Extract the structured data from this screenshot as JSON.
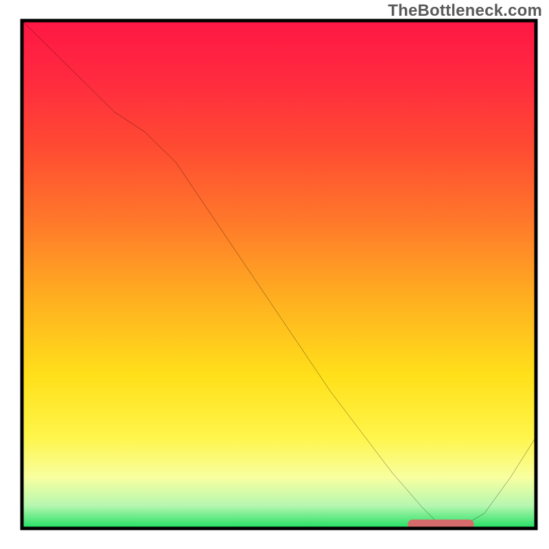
{
  "watermark": "TheBottleneck.com",
  "colors": {
    "frame": "#000000",
    "curve": "#000000",
    "target_marker_fill": "#d76a6a",
    "target_marker_stroke": "#c85a5a",
    "gradient_stops": [
      {
        "offset": 0.0,
        "color": "#ff1744"
      },
      {
        "offset": 0.12,
        "color": "#ff2b3f"
      },
      {
        "offset": 0.25,
        "color": "#ff4b32"
      },
      {
        "offset": 0.4,
        "color": "#ff7a2a"
      },
      {
        "offset": 0.55,
        "color": "#ffb020"
      },
      {
        "offset": 0.7,
        "color": "#ffe01a"
      },
      {
        "offset": 0.82,
        "color": "#fff54a"
      },
      {
        "offset": 0.9,
        "color": "#f8ffa0"
      },
      {
        "offset": 0.955,
        "color": "#b6f7b0"
      },
      {
        "offset": 1.0,
        "color": "#1fdf62"
      }
    ]
  },
  "chart_data": {
    "type": "line",
    "title": "",
    "xlabel": "",
    "ylabel": "",
    "xlim": [
      0,
      100
    ],
    "ylim": [
      0,
      100
    ],
    "x": [
      0,
      6,
      12,
      18,
      24,
      30,
      36,
      42,
      48,
      54,
      60,
      66,
      72,
      78,
      81,
      85,
      90,
      95,
      100
    ],
    "values": [
      100,
      94,
      88,
      82,
      78,
      72,
      63,
      54,
      45,
      36,
      27,
      19,
      11,
      4,
      1,
      0,
      3,
      10,
      18
    ],
    "note": "Curve y-values are approximate; axes have no tick labels in the image.",
    "target_region": {
      "x_start": 76,
      "x_end": 87,
      "y": 0.8
    }
  }
}
